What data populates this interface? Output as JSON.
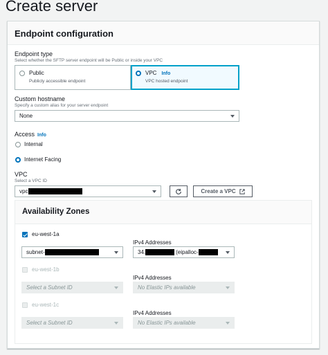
{
  "page": {
    "title": "Create server"
  },
  "endpoint_config": {
    "title": "Endpoint configuration",
    "endpoint_type": {
      "label": "Endpoint type",
      "description": "Select whether the SFTP server endpoint will be Public or inside your VPC",
      "options": [
        {
          "title": "Public",
          "description": "Publicly accessible endpoint",
          "selected": false
        },
        {
          "title": "VPC",
          "info": "Info",
          "description": "VPC hosted endpoint",
          "selected": true
        }
      ]
    },
    "custom_hostname": {
      "label": "Custom hostname",
      "description": "Specify a custom alias for your server endpoint",
      "value": "None"
    },
    "access": {
      "label": "Access",
      "info": "Info",
      "options": [
        {
          "label": "Internal",
          "selected": false
        },
        {
          "label": "Internet Facing",
          "selected": true
        }
      ]
    },
    "vpc": {
      "label": "VPC",
      "description": "Select a VPC ID",
      "value_prefix": "vpc",
      "create_label": "Create a VPC"
    }
  },
  "availability_zones": {
    "title": "Availability Zones",
    "zones": [
      {
        "name": "eu-west-1a",
        "checked": true,
        "subnet_prefix": "subnet-",
        "ipv4_label": "IPv4 Addresses",
        "ipv4_prefix": "34.",
        "ipv4_mid": "(eipalloc-"
      },
      {
        "name": "eu-west-1b",
        "checked": false,
        "subnet_placeholder": "Select a Subnet ID",
        "ipv4_label": "IPv4 Addresses",
        "ipv4_placeholder": "No Elastic IPs available"
      },
      {
        "name": "eu-west-1c",
        "checked": false,
        "subnet_placeholder": "Select a Subnet ID",
        "ipv4_label": "IPv4 Addresses",
        "ipv4_placeholder": "No Elastic IPs available"
      }
    ]
  },
  "colors": {
    "accent": "#0073bb",
    "selected_border": "#00a1c9",
    "selected_bg": "#f1faff"
  }
}
